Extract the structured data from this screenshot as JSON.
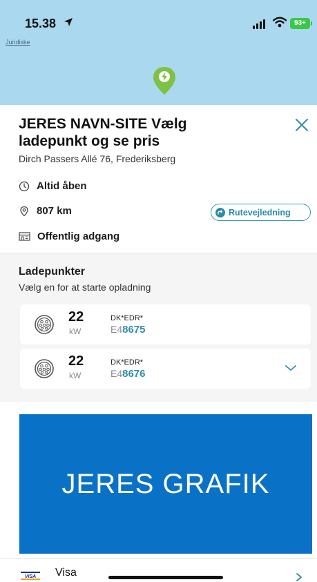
{
  "status_bar": {
    "time": "15.38",
    "battery": "93+"
  },
  "map": {
    "legal_link": "Juridiske"
  },
  "site": {
    "title": "JERES NAVN-SITE Vælg ladepunkt og se pris",
    "address": "Dirch Passers Allé 76, Frederiksberg",
    "opening_hours": "Altid åben",
    "distance": "807 km",
    "access": "Offentlig adgang",
    "route_button": "Rutevejledning"
  },
  "chargers": {
    "title": "Ladepunkter",
    "subtitle": "Vælg en for at starte opladning",
    "items": [
      {
        "power": "22",
        "unit": "kW",
        "evse_prefix": "DK*EDR*",
        "evse_start": "E4",
        "evse_highlight": "8675"
      },
      {
        "power": "22",
        "unit": "kW",
        "evse_prefix": "DK*EDR*",
        "evse_start": "E4",
        "evse_highlight": "8676"
      }
    ]
  },
  "banner": {
    "text": "JERES GRAFIK"
  },
  "payment": {
    "card_label": "Visa",
    "card_logo": "VISA"
  },
  "colors": {
    "map": "#aad8ef",
    "accent": "#2e8ea8",
    "pin": "#7dc242",
    "banner": "#0a72c6",
    "battery": "#3ac74a"
  },
  "icons": [
    "location-arrow-icon",
    "signal-icon",
    "wifi-icon",
    "charging-pin-icon",
    "close-icon",
    "clock-icon",
    "location-icon",
    "access-icon",
    "route-icon",
    "plug-icon",
    "chevron-down-icon",
    "chevron-right-icon"
  ]
}
